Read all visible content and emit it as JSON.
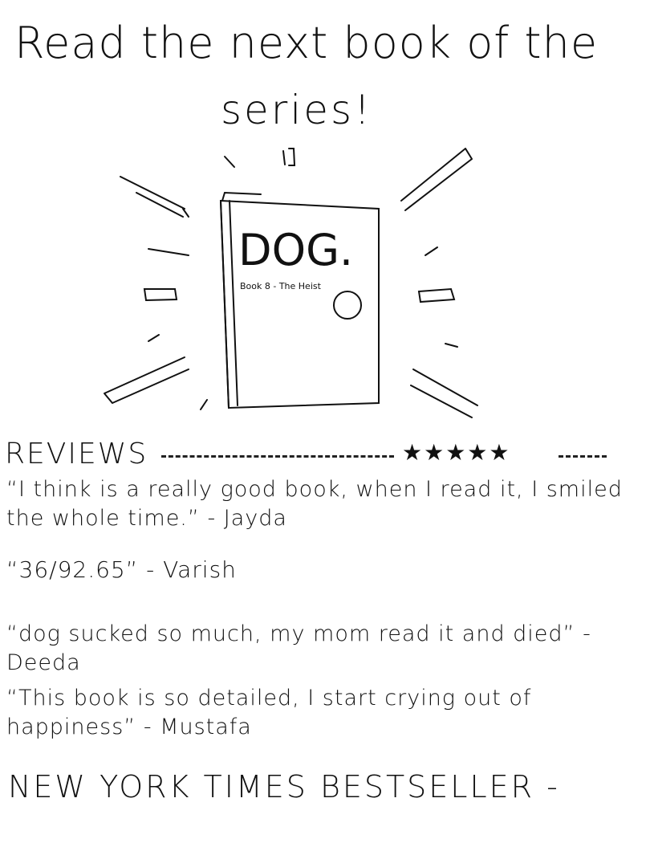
{
  "headline": {
    "line1": "Read the next book of the",
    "line2": "series!"
  },
  "book": {
    "title": "DOG.",
    "subtitle": "Book 8 - The Heist"
  },
  "reviews": {
    "label": "REVIEWS",
    "stars": "★★★★★",
    "items": [
      {
        "text": "“I think is a really good book, when I read it, I smiled the whole time.” - Jayda"
      },
      {
        "text": "“36/92.65” - Varish"
      },
      {
        "text": "“dog sucked so much, my mom read it and died” - Deeda"
      },
      {
        "text": "“This book is so detailed, I start crying out of happiness” - Mustafa"
      }
    ]
  },
  "footer": {
    "bestseller": "NEW YORK TIMES BESTSELLER -"
  }
}
